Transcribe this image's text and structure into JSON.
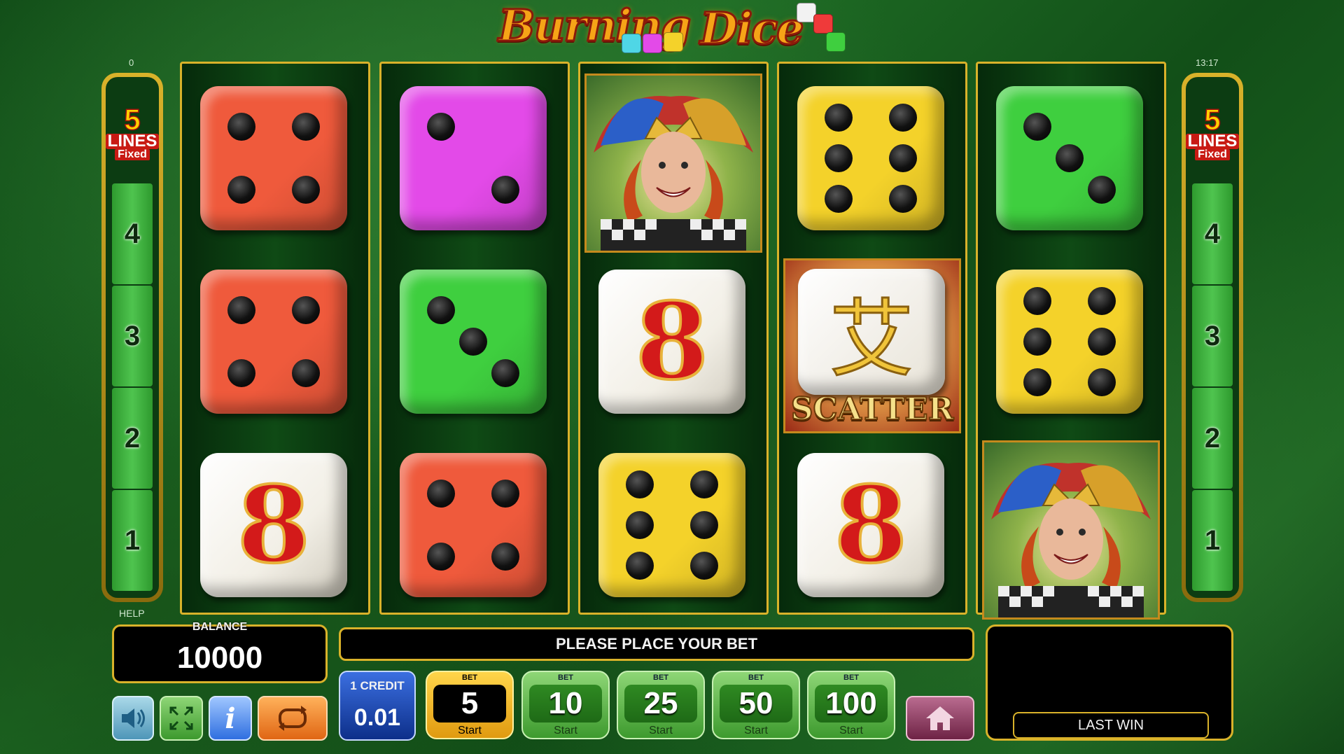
{
  "game": {
    "title_part1": "Burning",
    "title_part2": "Dice"
  },
  "top_left_readout": "0",
  "clock": "13:17",
  "help_label": "HELP",
  "lines_panel": {
    "count": "5",
    "label": "LINES",
    "mode": "Fixed",
    "line_numbers": [
      "4",
      "3",
      "2",
      "1"
    ]
  },
  "reels": [
    [
      {
        "type": "die",
        "color": "#ef5a3c",
        "pips": 4
      },
      {
        "type": "die",
        "color": "#ef5a3c",
        "pips": 4
      },
      {
        "type": "eight"
      }
    ],
    [
      {
        "type": "die",
        "color": "#e34ae8",
        "pips": 2
      },
      {
        "type": "die",
        "color": "#3fcf3f",
        "pips": 3
      },
      {
        "type": "die",
        "color": "#ef5a3c",
        "pips": 4
      }
    ],
    [
      {
        "type": "joker"
      },
      {
        "type": "eight"
      },
      {
        "type": "die",
        "color": "#f4d22a",
        "pips": 6
      }
    ],
    [
      {
        "type": "die",
        "color": "#f4d22a",
        "pips": 6
      },
      {
        "type": "scatter",
        "label": "SCATTER",
        "glyph": "艾"
      },
      {
        "type": "eight"
      }
    ],
    [
      {
        "type": "die",
        "color": "#3fcf3f",
        "pips": 3
      },
      {
        "type": "die",
        "color": "#f4d22a",
        "pips": 6
      },
      {
        "type": "joker"
      }
    ]
  ],
  "eight_glyph": "8",
  "balance": {
    "label": "BALANCE",
    "value": "10000"
  },
  "message": "PLEASE PLACE YOUR BET",
  "credit": {
    "label": "1 CREDIT",
    "value": "0.01"
  },
  "bets": [
    {
      "cap": "BET",
      "value": "5",
      "start": "Start",
      "selected": true
    },
    {
      "cap": "BET",
      "value": "10",
      "start": "Start",
      "selected": false
    },
    {
      "cap": "BET",
      "value": "25",
      "start": "Start",
      "selected": false
    },
    {
      "cap": "BET",
      "value": "50",
      "start": "Start",
      "selected": false
    },
    {
      "cap": "BET",
      "value": "100",
      "start": "Start",
      "selected": false
    }
  ],
  "last_win": {
    "label": "LAST WIN",
    "value": ""
  },
  "icons": {
    "sound": "speaker-icon",
    "fullscreen": "fullscreen-icon",
    "info": "info-icon",
    "autoplay": "autoplay-icon",
    "home": "home-icon"
  },
  "colors": {
    "gold": "#d9b22a",
    "red": "#ef5a3c",
    "magenta": "#e34ae8",
    "green": "#3fcf3f",
    "yellow": "#f4d22a"
  }
}
